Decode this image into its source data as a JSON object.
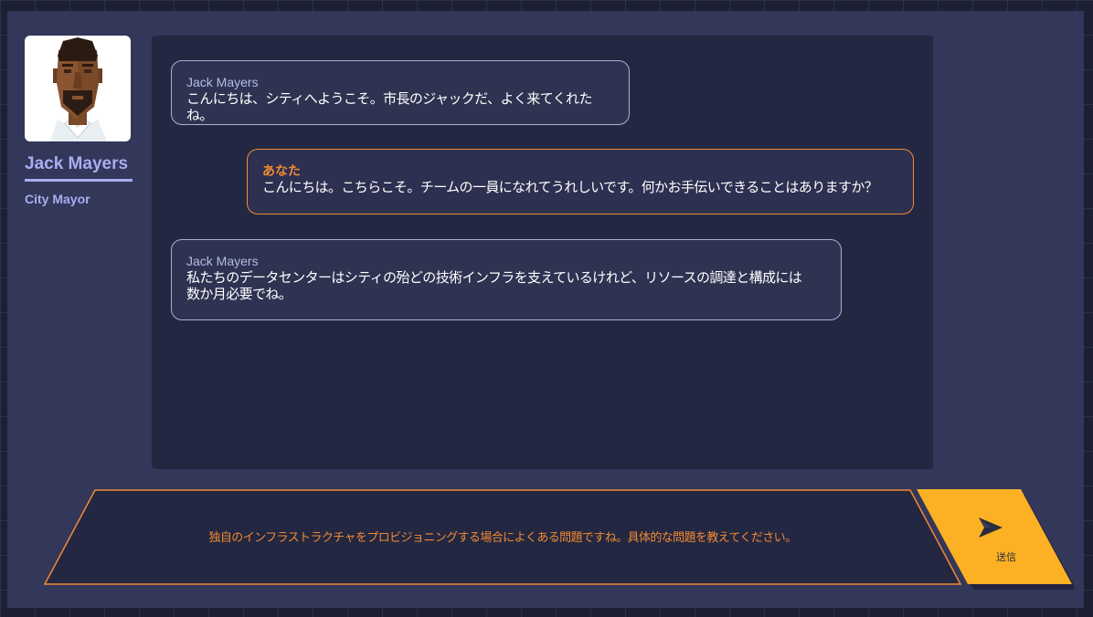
{
  "npc": {
    "name": "Jack Mayers",
    "role": "City Mayor"
  },
  "messages": [
    {
      "speaker": "Jack Mayers",
      "text": "こんにちは、シティへようこそ。市長のジャックだ、よく来てくれたね。"
    },
    {
      "speaker": "あなた",
      "text": "こんにちは。こちらこそ。チームの一員になれてうれしいです。何かお手伝いできることはありますか？"
    },
    {
      "speaker": "Jack Mayers",
      "text": "私たちのデータセンターはシティの殆どの技術インフラを支えているけれど、リソースの調達と構成には\n数か月必要でね。"
    }
  ],
  "input": {
    "value": "独自のインフラストラクチャをプロビジョニングする場合によくある問題ですね。具体的な問題を教えてください。"
  },
  "send": {
    "label": "送信",
    "icon": "send-arrow-icon"
  },
  "colors": {
    "background": "#1d2033",
    "panel": "#333759",
    "chat_background": "#232741",
    "npc_accent": "#a7aef0",
    "player_accent": "#f28a33",
    "send_button": "#fbb123"
  }
}
